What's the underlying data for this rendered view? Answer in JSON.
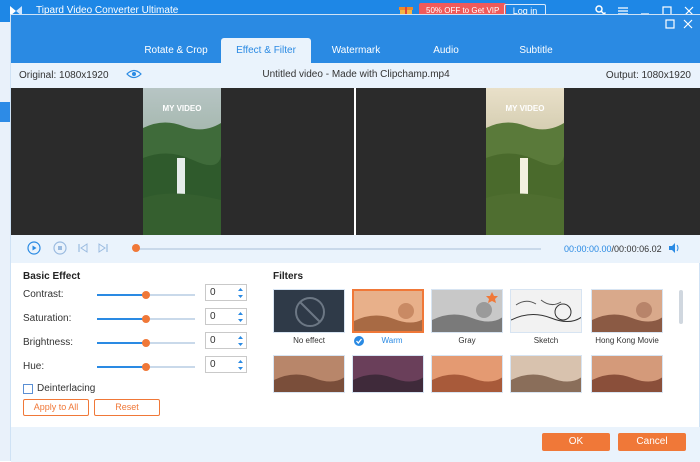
{
  "app": {
    "title": "Tipard Video Converter Ultimate",
    "promo": "50% OFF to Get VIP",
    "login": "Log in"
  },
  "dialog": {
    "tabs": [
      {
        "label": "Rotate & Crop",
        "active": false
      },
      {
        "label": "Effect & Filter",
        "active": true
      },
      {
        "label": "Watermark",
        "active": false
      },
      {
        "label": "Audio",
        "active": false
      },
      {
        "label": "Subtitle",
        "active": false
      }
    ],
    "original_label": "Original: 1080x1920",
    "file_name": "Untitled video - Made with Clipchamp.mp4",
    "output_label": "Output: 1080x1920",
    "video_overlay_text": "MY VIDEO"
  },
  "player": {
    "current_time": "00:00:00.00",
    "duration": "/00:00:06.02",
    "progress": 0.0
  },
  "basic_effect": {
    "title": "Basic Effect",
    "adjustments": [
      {
        "label": "Contrast:",
        "value": "0",
        "level": 0.5
      },
      {
        "label": "Saturation:",
        "value": "0",
        "level": 0.5
      },
      {
        "label": "Brightness:",
        "value": "0",
        "level": 0.5
      },
      {
        "label": "Hue:",
        "value": "0",
        "level": 0.5
      }
    ],
    "deinterlacing_label": "Deinterlacing",
    "deinterlacing_checked": false,
    "apply_all_label": "Apply to All",
    "reset_label": "Reset"
  },
  "filters": {
    "title": "Filters",
    "items": [
      {
        "label": "No effect",
        "selected": false
      },
      {
        "label": "Warm",
        "selected": true
      },
      {
        "label": "Gray",
        "selected": false
      },
      {
        "label": "Sketch",
        "selected": false
      },
      {
        "label": "Hong Kong Movie",
        "selected": false
      }
    ],
    "second_row_count": 5
  },
  "footer": {
    "ok_label": "OK",
    "cancel_label": "Cancel"
  },
  "colors": {
    "accent_blue": "#2a8ae3",
    "accent_orange": "#f07838",
    "promo_red": "#f05a5a"
  }
}
